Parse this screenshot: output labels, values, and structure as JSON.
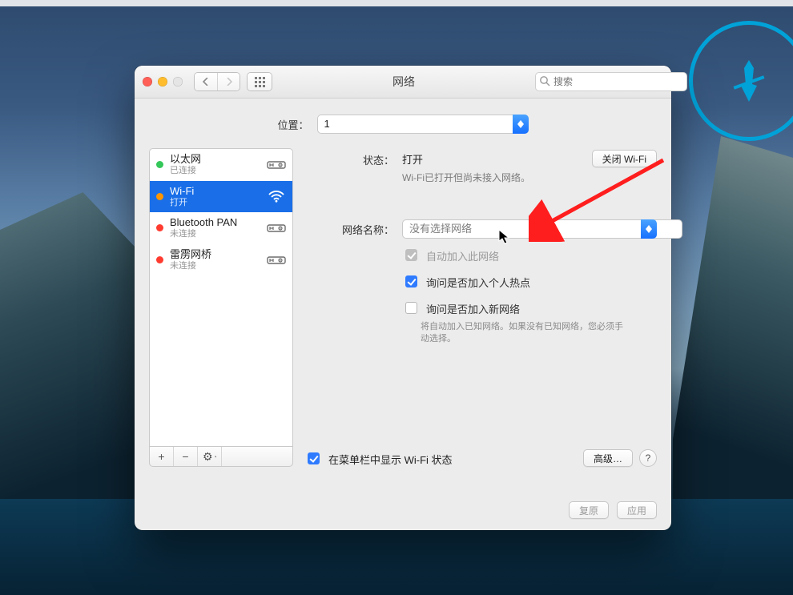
{
  "window": {
    "title": "网络",
    "search_placeholder": "搜索"
  },
  "location": {
    "label": "位置：",
    "value": "1"
  },
  "sidebar": {
    "items": [
      {
        "name": "以太网",
        "sub": "已连接",
        "dot": "green",
        "icon": "ethernet",
        "selected": false
      },
      {
        "name": "Wi-Fi",
        "sub": "打开",
        "dot": "orange",
        "icon": "wifi",
        "selected": true
      },
      {
        "name": "Bluetooth PAN",
        "sub": "未连接",
        "dot": "red",
        "icon": "ethernet",
        "selected": false
      },
      {
        "name": "雷雳网桥",
        "sub": "未连接",
        "dot": "red",
        "icon": "ethernet",
        "selected": false
      }
    ],
    "actions": {
      "add": "+",
      "remove": "−",
      "gear": "⚙︎"
    }
  },
  "detail": {
    "status_label": "状态：",
    "status_value": "打开",
    "wifi_toggle": "关闭 Wi-Fi",
    "status_hint": "Wi-Fi已打开但尚未接入网络。",
    "network_name_label": "网络名称：",
    "network_name_value": "没有选择网络",
    "checks": {
      "auto_join": "自动加入此网络",
      "ask_hotspot": "询问是否加入个人热点",
      "ask_new": "询问是否加入新网络",
      "ask_new_note": "将自动加入已知网络。如果没有已知网络，您必须手动选择。"
    },
    "show_in_menubar": "在菜单栏中显示 Wi-Fi 状态",
    "advanced": "高级…"
  },
  "footer": {
    "revert": "复原",
    "apply": "应用"
  }
}
